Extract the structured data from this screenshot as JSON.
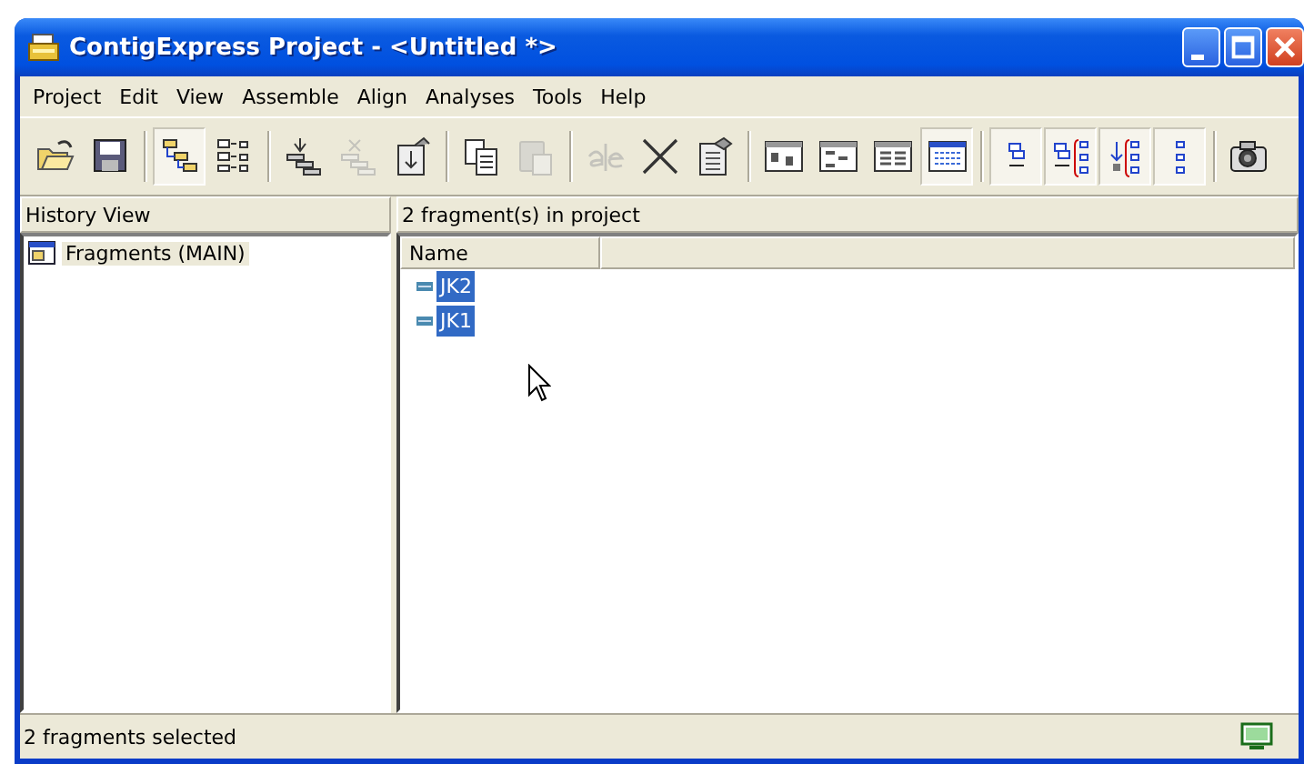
{
  "window": {
    "title": "ContigExpress Project - <Untitled *>"
  },
  "menu": [
    "Project",
    "Edit",
    "View",
    "Assemble",
    "Align",
    "Analyses",
    "Tools",
    "Help"
  ],
  "toolbar": {
    "groups": [
      [
        {
          "kind": "open",
          "pressed": false,
          "disabled": false
        },
        {
          "kind": "save",
          "pressed": false,
          "disabled": false
        }
      ],
      [
        {
          "kind": "tree",
          "pressed": true,
          "disabled": false
        },
        {
          "kind": "list",
          "pressed": false,
          "disabled": false
        }
      ],
      [
        {
          "kind": "assemble",
          "pressed": false,
          "disabled": false
        },
        {
          "kind": "unassemble",
          "pressed": false,
          "disabled": true
        },
        {
          "kind": "import",
          "pressed": false,
          "disabled": false
        }
      ],
      [
        {
          "kind": "copy",
          "pressed": false,
          "disabled": false
        },
        {
          "kind": "paste",
          "pressed": false,
          "disabled": true
        }
      ],
      [
        {
          "kind": "rename",
          "pressed": false,
          "disabled": true
        },
        {
          "kind": "delete",
          "pressed": false,
          "disabled": false
        },
        {
          "kind": "properties",
          "pressed": false,
          "disabled": false
        }
      ],
      [
        {
          "kind": "view-large",
          "pressed": false,
          "disabled": false
        },
        {
          "kind": "view-small",
          "pressed": false,
          "disabled": false
        },
        {
          "kind": "view-list",
          "pressed": false,
          "disabled": false
        },
        {
          "kind": "view-details",
          "pressed": true,
          "disabled": false
        }
      ],
      [
        {
          "kind": "align-one",
          "pressed": true,
          "disabled": false
        },
        {
          "kind": "align-two",
          "pressed": true,
          "disabled": false
        },
        {
          "kind": "align-three",
          "pressed": true,
          "disabled": false
        },
        {
          "kind": "align-four",
          "pressed": true,
          "disabled": false
        }
      ],
      [
        {
          "kind": "camera",
          "pressed": false,
          "disabled": false
        }
      ]
    ]
  },
  "history_view": {
    "title": "History View",
    "items": [
      {
        "label": "Fragments (MAIN)",
        "selected": true
      }
    ]
  },
  "fragments": {
    "title": "2 fragment(s) in project",
    "columns": [
      "Name"
    ],
    "rows": [
      {
        "name": "JK2",
        "selected": true
      },
      {
        "name": "JK1",
        "selected": true
      }
    ]
  },
  "status_bar": {
    "text": "2 fragments selected"
  }
}
